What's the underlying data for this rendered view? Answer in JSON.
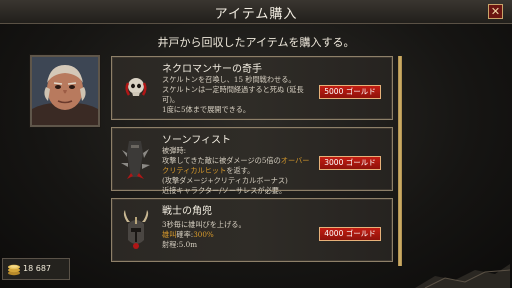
{
  "window": {
    "title": "アイテム購入",
    "close_label": "✕"
  },
  "subtitle": "井戸から回収したアイテムを購入する。",
  "items": [
    {
      "name": "ネクロマンサーの奇手",
      "icon": "skull-hand-icon",
      "desc_lines": [
        "スケルトンを召喚し、15 秒間戦わせる。",
        "スケルトンは一定時間経過すると死ぬ (延長",
        "可)。",
        "1度に5体まで展開できる。"
      ],
      "price": "5000 ゴールド"
    },
    {
      "name": "ソーンフィスト",
      "icon": "spiked-gauntlet-icon",
      "desc_line1": "被弾時:",
      "desc_line2a": "攻撃してきた敵に被ダメージの5倍の",
      "desc_line2b": "オーバー",
      "desc_line3": "クリティカルヒット",
      "desc_line3b": "を返す。",
      "desc_line4": "(攻撃ダメージ+クリティカルボーナス)",
      "desc_line5": "近接キャラクター/ソーサレスが必要。",
      "price": "3000 ゴールド"
    },
    {
      "name": "戦士の角兜",
      "icon": "horned-helmet-icon",
      "desc_line1": "3秒毎に雄叫びを上げる。",
      "desc_line2a": "雄叫",
      "desc_line2b": "確率:",
      "desc_line2c": "300%",
      "desc_line3": "射程:5.0m",
      "price": "4000 ゴールド"
    }
  ],
  "gold": {
    "icon": "gold-coins-icon",
    "amount": "18 687"
  },
  "colors": {
    "accent_orange": "#d89a2b",
    "button_red": "#c21d12",
    "frame_gold": "#8e8069"
  }
}
